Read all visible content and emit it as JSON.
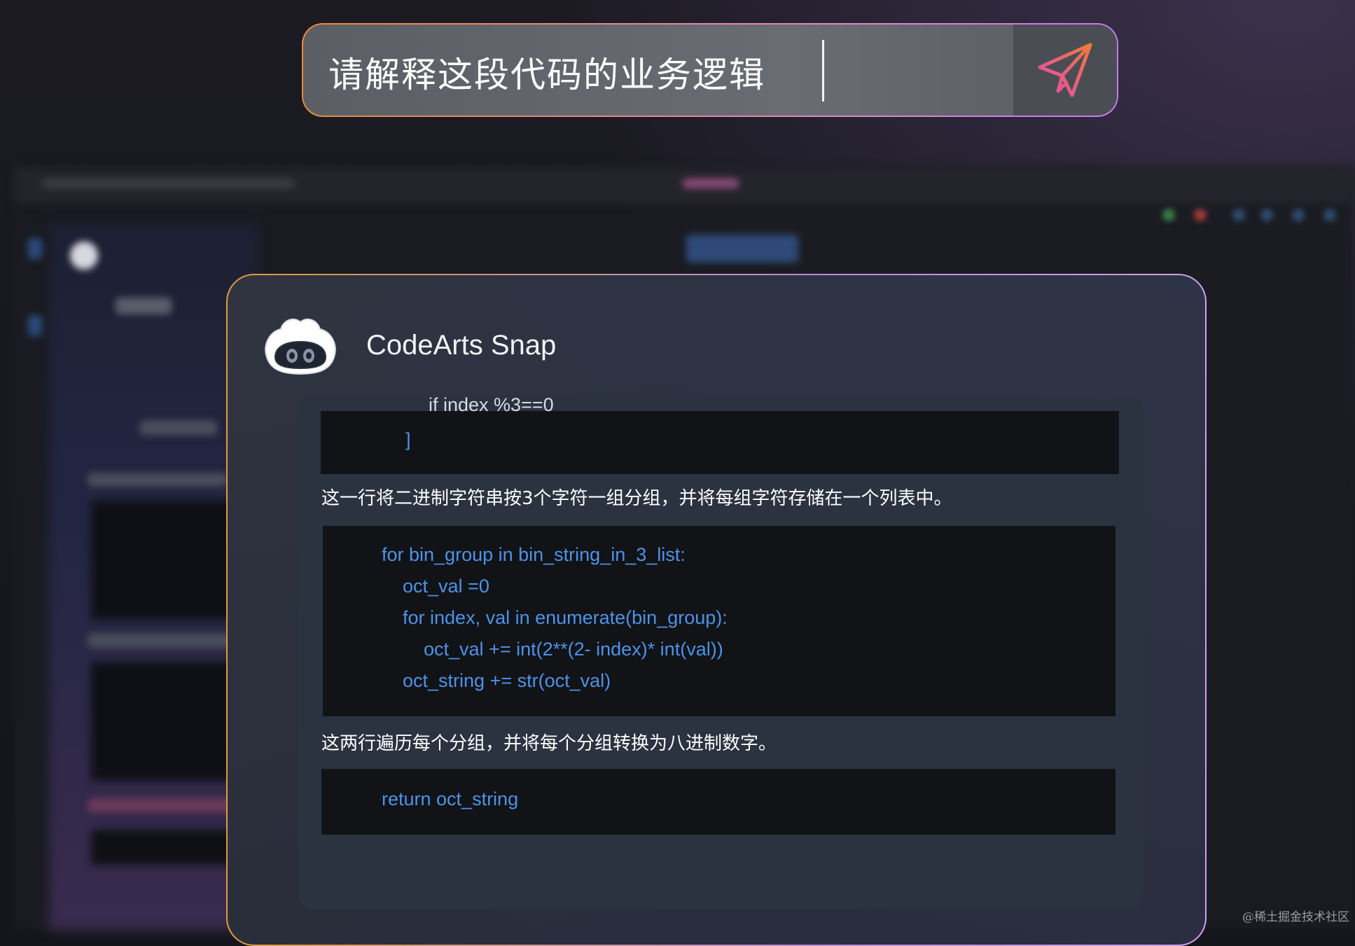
{
  "prompt": {
    "text": "请解释这段代码的业务逻辑"
  },
  "assistant": {
    "name": "CodeArts Snap"
  },
  "response": {
    "code_block_1": {
      "partial_line": "if index %3==0",
      "closing_line": "]"
    },
    "explanation_1": "这一行将二进制字符串按3个字符一组分组，并将每组字符存储在一个列表中。",
    "code_block_2": {
      "lines": [
        "for bin_group in bin_string_in_3_list:",
        "    oct_val =0",
        "    for index, val in enumerate(bin_group):",
        "        oct_val += int(2**(2- index)* int(val))",
        "    oct_string += str(oct_val)"
      ]
    },
    "explanation_2": "这两行遍历每个分组，并将每个分组转换为八进制数字。",
    "code_block_3": {
      "lines": [
        "return oct_string"
      ]
    }
  },
  "watermark": "@稀土掘金技术社区",
  "colors": {
    "code_text": "#4c93e8",
    "border_start": "#e88a3a",
    "border_end": "#c47ae8"
  }
}
